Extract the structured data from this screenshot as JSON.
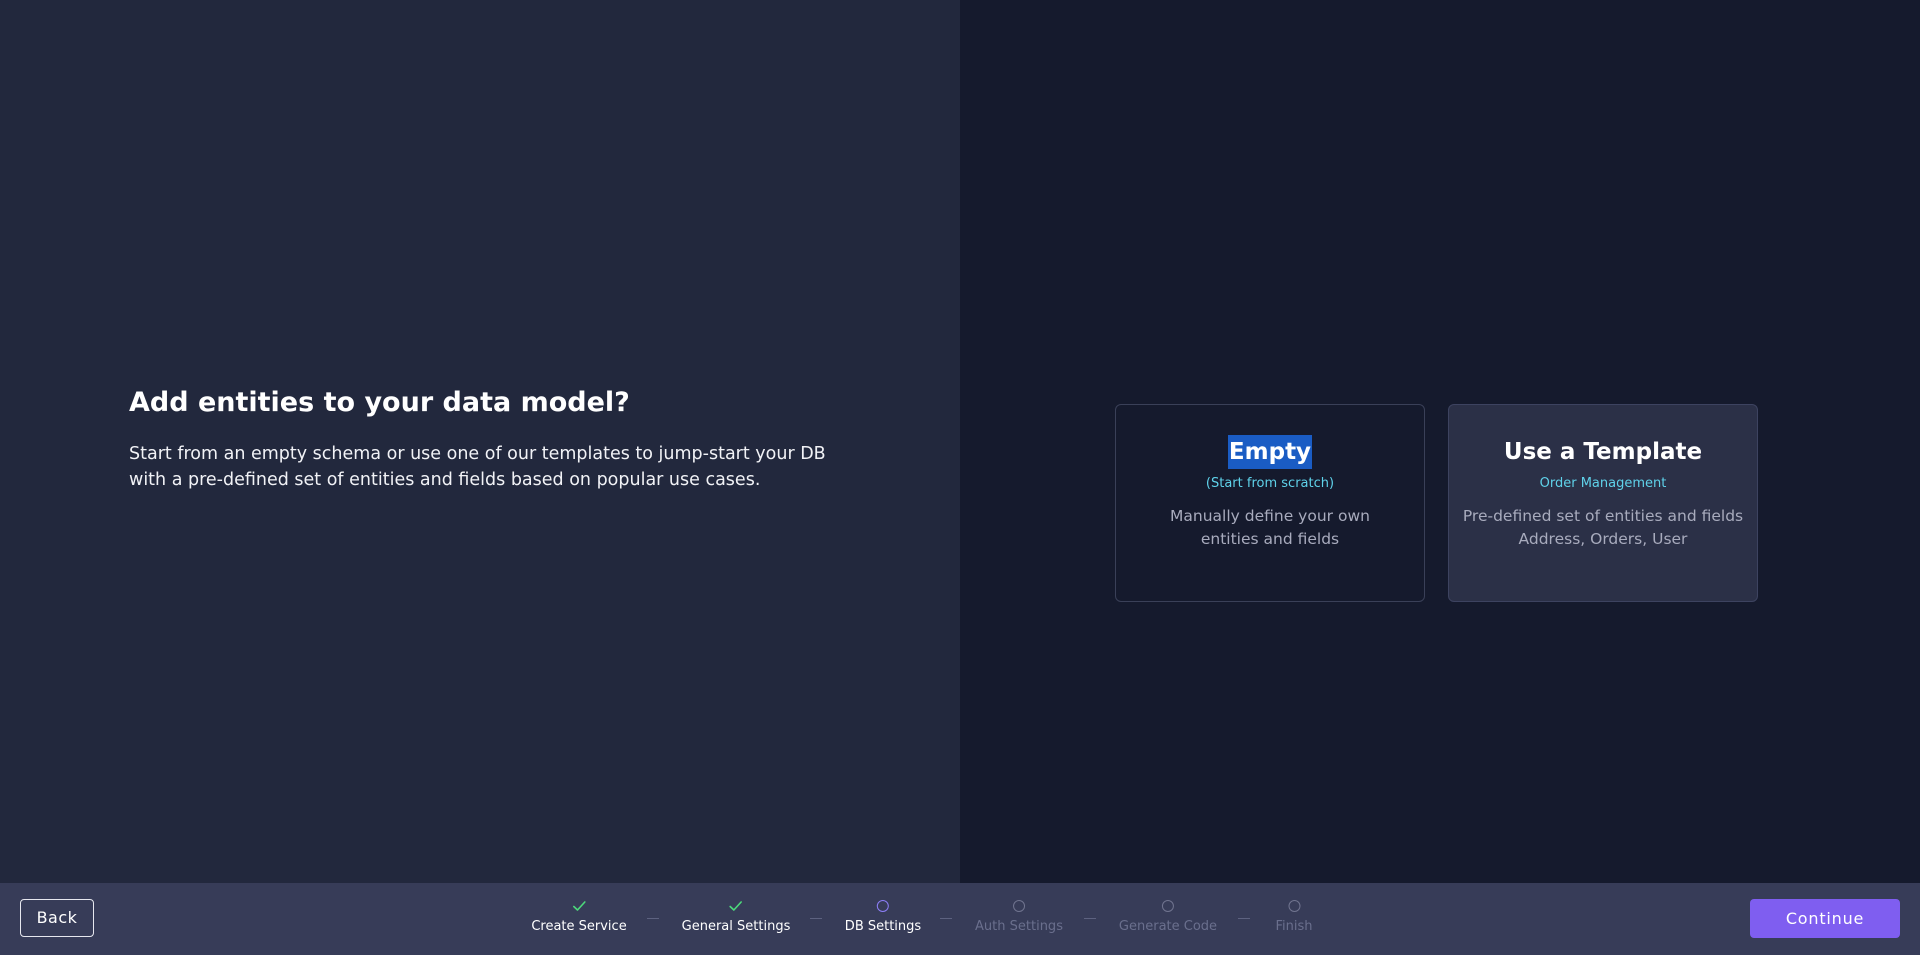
{
  "intro": {
    "title": "Add entities to your data model?",
    "description": "Start from an empty schema or use one of our templates to jump-start your DB with a pre-defined set of entities and fields based on popular use cases."
  },
  "options": {
    "empty": {
      "title": "Empty",
      "subtitle": "(Start from scratch)",
      "description": "Manually define your own entities and fields",
      "selected_text": "Empty"
    },
    "template": {
      "title": "Use a Template",
      "subtitle": "Order Management",
      "description_line1": "Pre-defined set of entities and fields",
      "description_line2": "Address, Orders, User"
    }
  },
  "footer": {
    "back_label": "Back",
    "continue_label": "Continue",
    "steps": [
      {
        "label": "Create Service",
        "state": "done",
        "icon": "check-icon"
      },
      {
        "label": "General Settings",
        "state": "done",
        "icon": "check-icon"
      },
      {
        "label": "DB Settings",
        "state": "current",
        "icon": "circle-icon"
      },
      {
        "label": "Auth Settings",
        "state": "pending",
        "icon": "circle-icon"
      },
      {
        "label": "Generate Code",
        "state": "pending",
        "icon": "circle-icon"
      },
      {
        "label": "Finish",
        "state": "pending",
        "icon": "circle-icon"
      }
    ]
  },
  "colors": {
    "accent": "#7f5ef0",
    "check": "#4cd97b",
    "subtitle": "#5fd2ea",
    "selection": "#1a5cc4"
  }
}
